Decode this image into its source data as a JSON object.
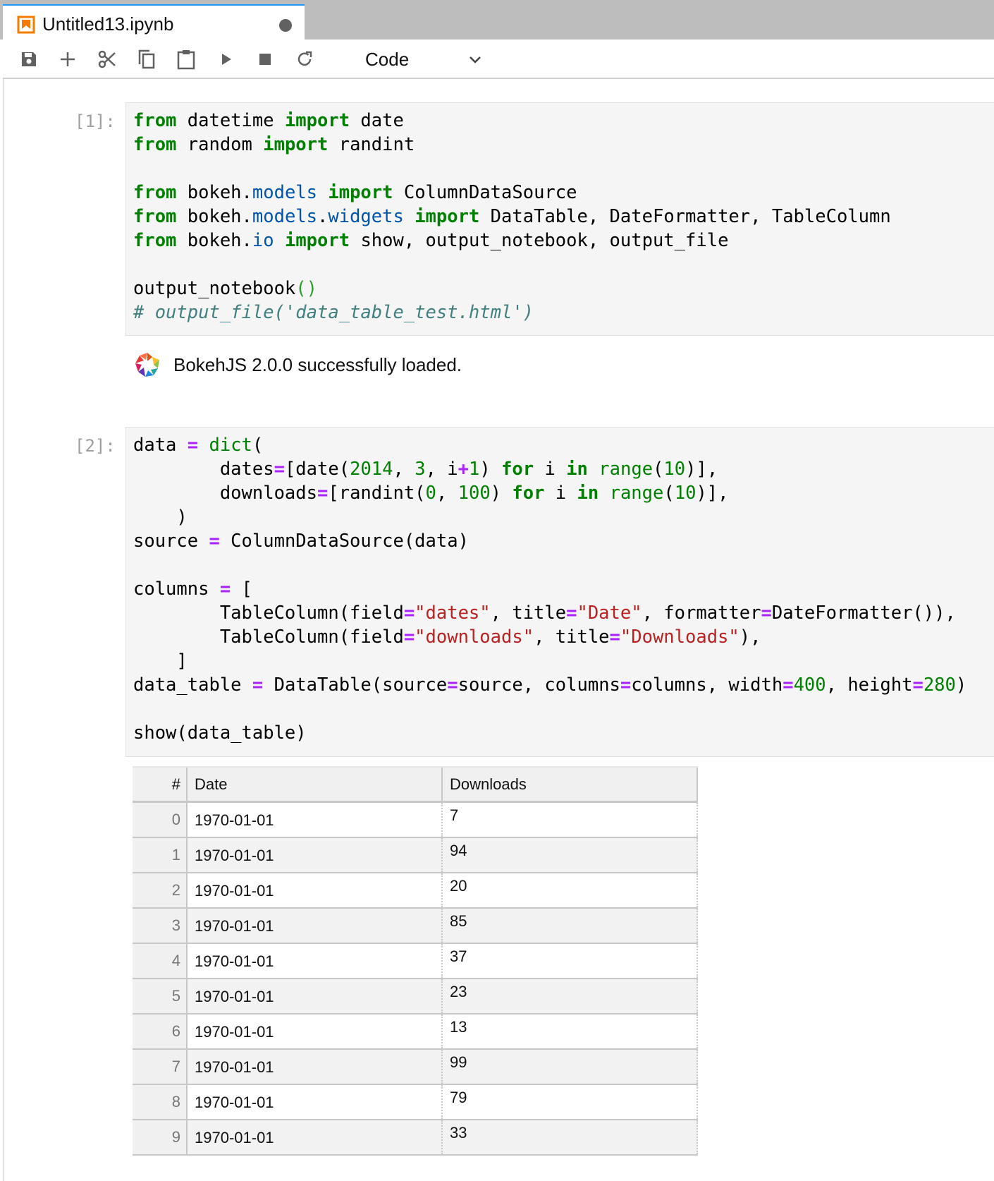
{
  "tab": {
    "title": "Untitled13.ipynb"
  },
  "toolbar": {
    "buttons": [
      "save-icon",
      "add-cell-icon",
      "cut-icon",
      "copy-icon",
      "paste-icon",
      "run-icon",
      "stop-icon",
      "restart-icon"
    ],
    "cell_type": "Code"
  },
  "cells": [
    {
      "prompt": "[1]:"
    },
    {
      "prompt": "[2]:"
    }
  ],
  "bokeh": {
    "message": "BokehJS 2.0.0 successfully loaded."
  },
  "table": {
    "columns": [
      "#",
      "Date",
      "Downloads"
    ],
    "rows": [
      {
        "index": "0",
        "date": "1970-01-01",
        "downloads": "7"
      },
      {
        "index": "1",
        "date": "1970-01-01",
        "downloads": "94"
      },
      {
        "index": "2",
        "date": "1970-01-01",
        "downloads": "20"
      },
      {
        "index": "3",
        "date": "1970-01-01",
        "downloads": "85"
      },
      {
        "index": "4",
        "date": "1970-01-01",
        "downloads": "37"
      },
      {
        "index": "5",
        "date": "1970-01-01",
        "downloads": "23"
      },
      {
        "index": "6",
        "date": "1970-01-01",
        "downloads": "13"
      },
      {
        "index": "7",
        "date": "1970-01-01",
        "downloads": "99"
      },
      {
        "index": "8",
        "date": "1970-01-01",
        "downloads": "79"
      },
      {
        "index": "9",
        "date": "1970-01-01",
        "downloads": "33"
      }
    ]
  }
}
